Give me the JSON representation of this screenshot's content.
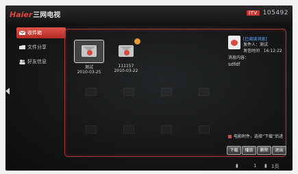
{
  "brand": {
    "name": "Haier",
    "product": "三网电视"
  },
  "status": {
    "badge": "ITV",
    "number": "105492"
  },
  "sidebar": {
    "items": [
      {
        "label": "收件箱",
        "active": true
      },
      {
        "label": "文件分享",
        "active": false
      },
      {
        "label": "好友信息",
        "active": false
      }
    ]
  },
  "messages": [
    {
      "name": "测试",
      "date": "2010-03-25",
      "selected": true
    },
    {
      "name": "111157",
      "date": "2010-03-22",
      "selected": false
    }
  ],
  "detail": {
    "title": "[已阅读消息]",
    "sender": "发件人：测试",
    "time_label": "发信时间",
    "time_value": "16:12:22",
    "content_label": "消息内容：",
    "content": "sdfdf"
  },
  "hint": "电影附件，选择“下载”后进",
  "buttons": [
    "下载",
    "播放",
    "删除",
    "退出"
  ],
  "bottom": {
    "page": "1",
    "total": "1页"
  },
  "colors": {
    "accent": "#c2362f",
    "panel_border": "#a83a35",
    "link": "#6fb3ff"
  }
}
